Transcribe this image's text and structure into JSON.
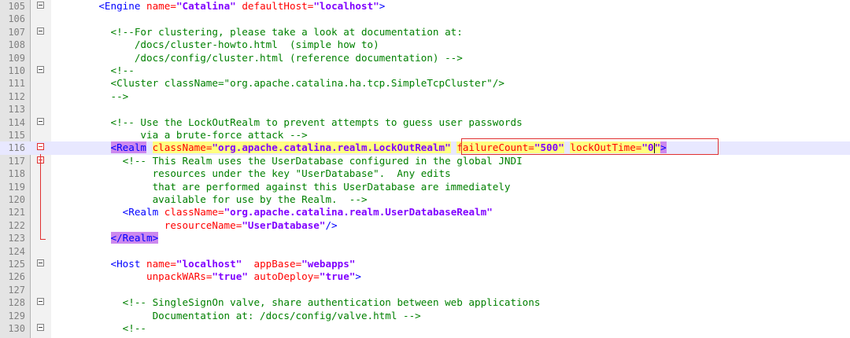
{
  "lines": [
    {
      "num": "105",
      "fold": true,
      "parts": [
        {
          "t": "    "
        },
        {
          "t": "<Engine ",
          "c": "t"
        },
        {
          "t": "name=",
          "c": "a"
        },
        {
          "t": "\"Catalina\"",
          "c": "v"
        },
        {
          "t": " defaultHost=",
          "c": "a"
        },
        {
          "t": "\"localhost\"",
          "c": "v"
        },
        {
          "t": ">",
          "c": "t"
        }
      ]
    },
    {
      "num": "106",
      "parts": []
    },
    {
      "num": "107",
      "fold": true,
      "parts": [
        {
          "t": "      "
        },
        {
          "t": "<!--For clustering, please take a look at documentation at:",
          "c": "c"
        }
      ]
    },
    {
      "num": "108",
      "parts": [
        {
          "t": "          /docs/cluster-howto.html  (simple how to)",
          "c": "c"
        }
      ]
    },
    {
      "num": "109",
      "parts": [
        {
          "t": "          /docs/config/cluster.html (reference documentation) -->",
          "c": "c"
        }
      ]
    },
    {
      "num": "110",
      "fold": true,
      "parts": [
        {
          "t": "      "
        },
        {
          "t": "<!--",
          "c": "c"
        }
      ]
    },
    {
      "num": "111",
      "parts": [
        {
          "t": "      <Cluster className=\"org.apache.catalina.ha.tcp.SimpleTcpCluster\"/>",
          "c": "c"
        }
      ]
    },
    {
      "num": "112",
      "parts": [
        {
          "t": "      -->",
          "c": "c"
        }
      ]
    },
    {
      "num": "113",
      "parts": []
    },
    {
      "num": "114",
      "fold": true,
      "parts": [
        {
          "t": "      "
        },
        {
          "t": "<!-- Use the LockOutRealm to prevent attempts to guess user passwords",
          "c": "c"
        }
      ]
    },
    {
      "num": "115",
      "parts": [
        {
          "t": "           via a brute-force attack -->",
          "c": "c"
        }
      ]
    },
    {
      "num": "116",
      "fold": true,
      "foldRed": true,
      "current": true,
      "parts": [
        {
          "t": "      "
        },
        {
          "t": "<Realm",
          "c": "tagpurple"
        },
        {
          "t": " "
        },
        {
          "t": "className=",
          "c": "a hl"
        },
        {
          "t": "\"org.apache.catalina.realm.LockOutRealm\"",
          "c": "v hl"
        },
        {
          "t": " "
        },
        {
          "t": "failureCount=",
          "c": "a hl"
        },
        {
          "t": "\"500\"",
          "c": "v hl"
        },
        {
          "t": " "
        },
        {
          "t": "lockOutTime=",
          "c": "a hl"
        },
        {
          "t": "\"0",
          "c": "v hl"
        },
        {
          "caret": true
        },
        {
          "t": "\"",
          "c": "v hl"
        },
        {
          "t": ">",
          "c": "tagpurple"
        }
      ]
    },
    {
      "num": "117",
      "fold": true,
      "foldRed": true,
      "parts": [
        {
          "t": "        "
        },
        {
          "t": "<!-- This Realm uses the UserDatabase configured in the global JNDI",
          "c": "c"
        }
      ]
    },
    {
      "num": "118",
      "parts": [
        {
          "t": "             resources under the key \"UserDatabase\".  Any edits",
          "c": "c"
        }
      ]
    },
    {
      "num": "119",
      "parts": [
        {
          "t": "             that are performed against this UserDatabase are immediately",
          "c": "c"
        }
      ]
    },
    {
      "num": "120",
      "parts": [
        {
          "t": "             available for use by the Realm.  -->",
          "c": "c"
        }
      ]
    },
    {
      "num": "121",
      "parts": [
        {
          "t": "        "
        },
        {
          "t": "<Realm ",
          "c": "t"
        },
        {
          "t": "className=",
          "c": "a"
        },
        {
          "t": "\"org.apache.catalina.realm.UserDatabaseRealm\"",
          "c": "v"
        }
      ]
    },
    {
      "num": "122",
      "parts": [
        {
          "t": "               "
        },
        {
          "t": "resourceName=",
          "c": "a"
        },
        {
          "t": "\"UserDatabase\"",
          "c": "v"
        },
        {
          "t": "/>",
          "c": "t"
        }
      ]
    },
    {
      "num": "123",
      "parts": [
        {
          "t": "      "
        },
        {
          "t": "</Realm>",
          "c": "tagpurple"
        }
      ]
    },
    {
      "num": "124",
      "parts": []
    },
    {
      "num": "125",
      "fold": true,
      "parts": [
        {
          "t": "      "
        },
        {
          "t": "<Host ",
          "c": "t"
        },
        {
          "t": "name=",
          "c": "a"
        },
        {
          "t": "\"localhost\"",
          "c": "v"
        },
        {
          "t": "  appBase=",
          "c": "a"
        },
        {
          "t": "\"webapps\"",
          "c": "v"
        }
      ]
    },
    {
      "num": "126",
      "parts": [
        {
          "t": "            "
        },
        {
          "t": "unpackWARs=",
          "c": "a"
        },
        {
          "t": "\"true\"",
          "c": "v"
        },
        {
          "t": " autoDeploy=",
          "c": "a"
        },
        {
          "t": "\"true\"",
          "c": "v"
        },
        {
          "t": ">",
          "c": "t"
        }
      ]
    },
    {
      "num": "127",
      "parts": []
    },
    {
      "num": "128",
      "fold": true,
      "parts": [
        {
          "t": "        "
        },
        {
          "t": "<!-- SingleSignOn valve, share authentication between web applications",
          "c": "c"
        }
      ]
    },
    {
      "num": "129",
      "parts": [
        {
          "t": "             Documentation at: /docs/config/valve.html -->",
          "c": "c"
        }
      ]
    },
    {
      "num": "130",
      "fold": true,
      "parts": [
        {
          "t": "        "
        },
        {
          "t": "<!--",
          "c": "c"
        }
      ]
    }
  ]
}
